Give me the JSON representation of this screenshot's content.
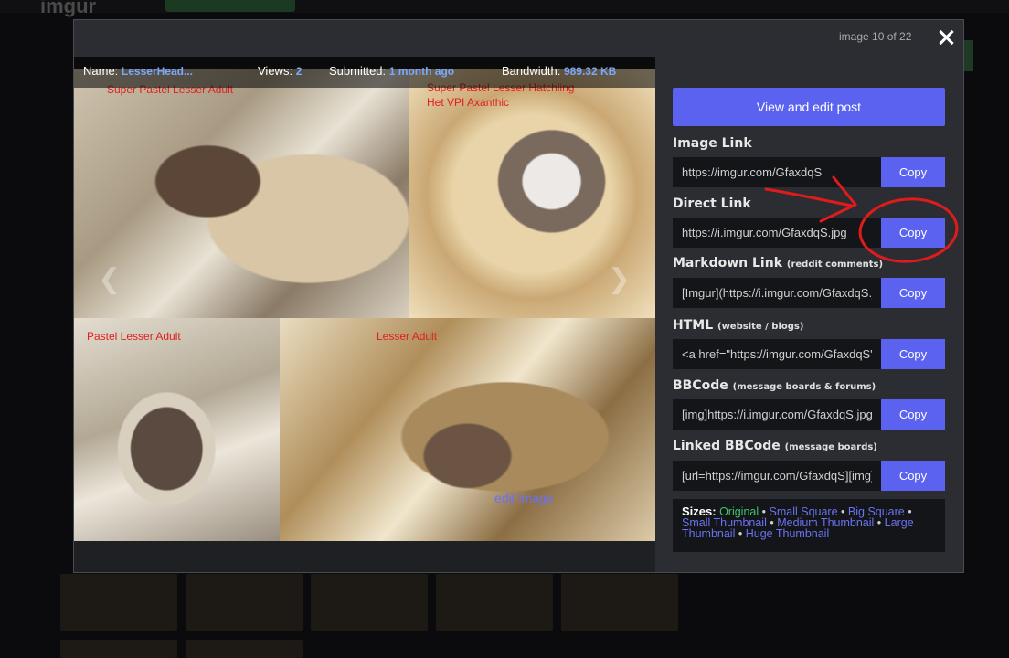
{
  "background": {
    "logo": "imgur",
    "new_post_label": ""
  },
  "modal": {
    "counter": "image 10 of 22",
    "meta": {
      "name_key": "Name:",
      "name_value": "LesserHead...",
      "views_key": "Views:",
      "views_value": "2",
      "submitted_key": "Submitted:",
      "submitted_value": "1 month ago",
      "bandwidth_key": "Bandwidth:",
      "bandwidth_value": "989.32 KB"
    },
    "panels": [
      {
        "label": "Super Pastel Lesser Adult"
      },
      {
        "label_line1": "Super Pastel Lesser Hatchling",
        "label_line2": "Het VPI Axanthic"
      },
      {
        "label": "Pastel Lesser Adult"
      },
      {
        "label": "Lesser Adult"
      }
    ],
    "nav_prev": "❮",
    "nav_next": "❯",
    "edit_image": "edit image"
  },
  "side": {
    "view_edit": "View and edit post",
    "links": [
      {
        "label": "Image Link",
        "sub": "",
        "value": "https://imgur.com/GfaxdqS",
        "copy": "Copy"
      },
      {
        "label": "Direct Link",
        "sub": "",
        "value": "https://i.imgur.com/GfaxdqS.jpg",
        "copy": "Copy"
      },
      {
        "label": "Markdown Link",
        "sub": "(reddit comments)",
        "value": "[Imgur](https://i.imgur.com/GfaxdqS.jpg)",
        "copy": "Copy"
      },
      {
        "label": "HTML",
        "sub": "(website / blogs)",
        "value": "<a href=\"https://imgur.com/GfaxdqS\">",
        "copy": "Copy"
      },
      {
        "label": "BBCode",
        "sub": "(message boards & forums)",
        "value": "[img]https://i.imgur.com/GfaxdqS.jpg[/img]",
        "copy": "Copy"
      },
      {
        "label": "Linked BBCode",
        "sub": "(message boards)",
        "value": "[url=https://imgur.com/GfaxdqS][img]",
        "copy": "Copy"
      }
    ],
    "sizes": {
      "label": "Sizes:",
      "original": "Original",
      "options": [
        "Small Square",
        "Big Square",
        "Small Thumbnail",
        "Medium Thumbnail",
        "Large Thumbnail",
        "Huge Thumbnail"
      ],
      "separator": "•"
    }
  },
  "colors": {
    "accent": "#5b62f0",
    "original_green": "#3ec46d",
    "annotation_red": "#e01b1b",
    "panel_label_red": "#e02020"
  }
}
